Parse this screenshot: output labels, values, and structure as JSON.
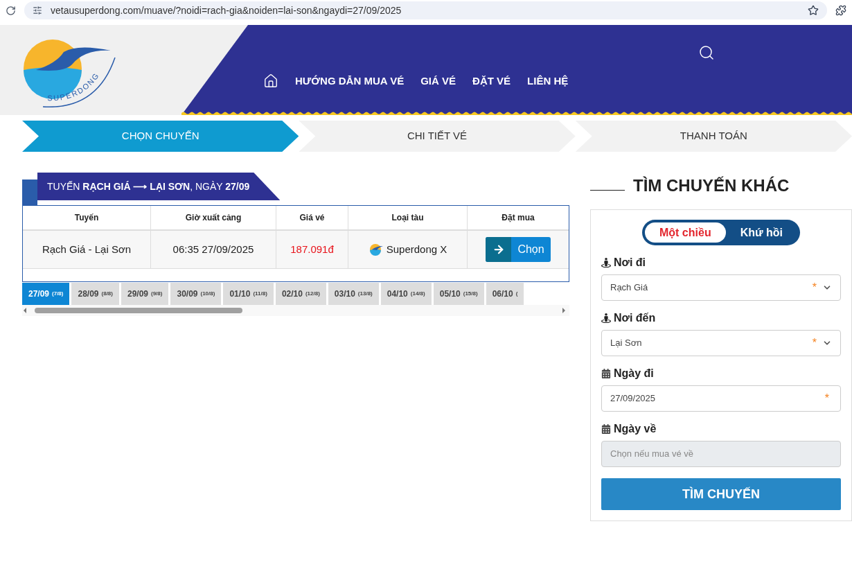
{
  "browser": {
    "url": "vetausuperdong.com/muave/?noidi=rach-gia&noiden=lai-son&ngaydi=27/09/2025"
  },
  "header": {
    "logo_text": "SUPERDONG",
    "nav": [
      "HƯỚNG DẪN MUA VÉ",
      "GIÁ VÉ",
      "ĐẶT VÉ",
      "LIÊN HỆ"
    ]
  },
  "steps": [
    {
      "label": "CHỌN CHUYẾN",
      "selected": true
    },
    {
      "label": "CHI TIẾT VÉ",
      "selected": false
    },
    {
      "label": "THANH TOÁN",
      "selected": false
    }
  ],
  "route_banner": "TUYẾN **RẠCH GIÁ ⟶ LẠI SƠN**, NGÀY **27/09**",
  "table": {
    "columns": [
      "Tuyến",
      "Giờ xuất cảng",
      "Giá vé",
      "Loại tàu",
      "Đặt mua"
    ],
    "rows": [
      {
        "route": "Rạch Giá - Lại Sơn",
        "departure": "06:35 27/09/2025",
        "price": "187.091đ",
        "ship": "Superdong X",
        "action": "Chọn"
      }
    ]
  },
  "date_tabs": [
    {
      "date": "27/09",
      "count": "(7/8)",
      "selected": true
    },
    {
      "date": "28/09",
      "count": "(8/8)",
      "selected": false
    },
    {
      "date": "29/09",
      "count": "(9/8)",
      "selected": false
    },
    {
      "date": "30/09",
      "count": "(10/8)",
      "selected": false
    },
    {
      "date": "01/10",
      "count": "(11/8)",
      "selected": false
    },
    {
      "date": "02/10",
      "count": "(12/8)",
      "selected": false
    },
    {
      "date": "03/10",
      "count": "(13/8)",
      "selected": false
    },
    {
      "date": "04/10",
      "count": "(14/8)",
      "selected": false
    },
    {
      "date": "05/10",
      "count": "(15/8)",
      "selected": false
    },
    {
      "date": "06/10",
      "count": "(",
      "selected": false
    }
  ],
  "search": {
    "title": "TÌM CHUYẾN KHÁC",
    "trip_types": [
      {
        "label": "Một chiều",
        "selected": true
      },
      {
        "label": "Khứ hồi",
        "selected": false
      }
    ],
    "fields": [
      {
        "kind": "select",
        "label": "Nơi đi",
        "value": "Rạch Giá",
        "required_mark": "*"
      },
      {
        "kind": "select",
        "label": "Nơi đến",
        "value": "Lại Sơn",
        "required_mark": "*"
      },
      {
        "kind": "input",
        "label": "Ngày đi",
        "value": "27/09/2025",
        "required_mark": "*"
      },
      {
        "kind": "disabled",
        "label": "Ngày về",
        "placeholder": "Chọn nếu mua vé về"
      }
    ],
    "submit": "TÌM CHUYẾN"
  }
}
